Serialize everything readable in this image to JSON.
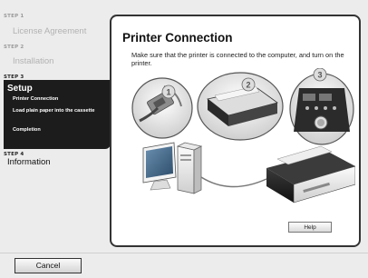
{
  "sidebar": {
    "steps": [
      {
        "num": "STEP 1",
        "title": "License Agreement"
      },
      {
        "num": "STEP 2",
        "title": "Installation"
      },
      {
        "num": "STEP 3",
        "title": "Setup",
        "subitems": [
          "Printer Connection",
          "Load plain paper into the cassette",
          "Completion"
        ]
      },
      {
        "num": "STEP 4",
        "title": "Information"
      }
    ]
  },
  "panel": {
    "heading": "Printer Connection",
    "description": "Make sure that the printer is connected to the computer, and turn on the printer.",
    "callouts": [
      "1",
      "2",
      "3"
    ],
    "help_label": "Help"
  },
  "footer": {
    "cancel_label": "Cancel"
  },
  "icons": [
    "usb-cable-icon",
    "printer-icon",
    "computer-icon",
    "power-button-icon"
  ],
  "colors": {
    "active_bg": "#1c1c1c",
    "inactive_text": "#b2b2b2",
    "panel_border": "#333333"
  }
}
